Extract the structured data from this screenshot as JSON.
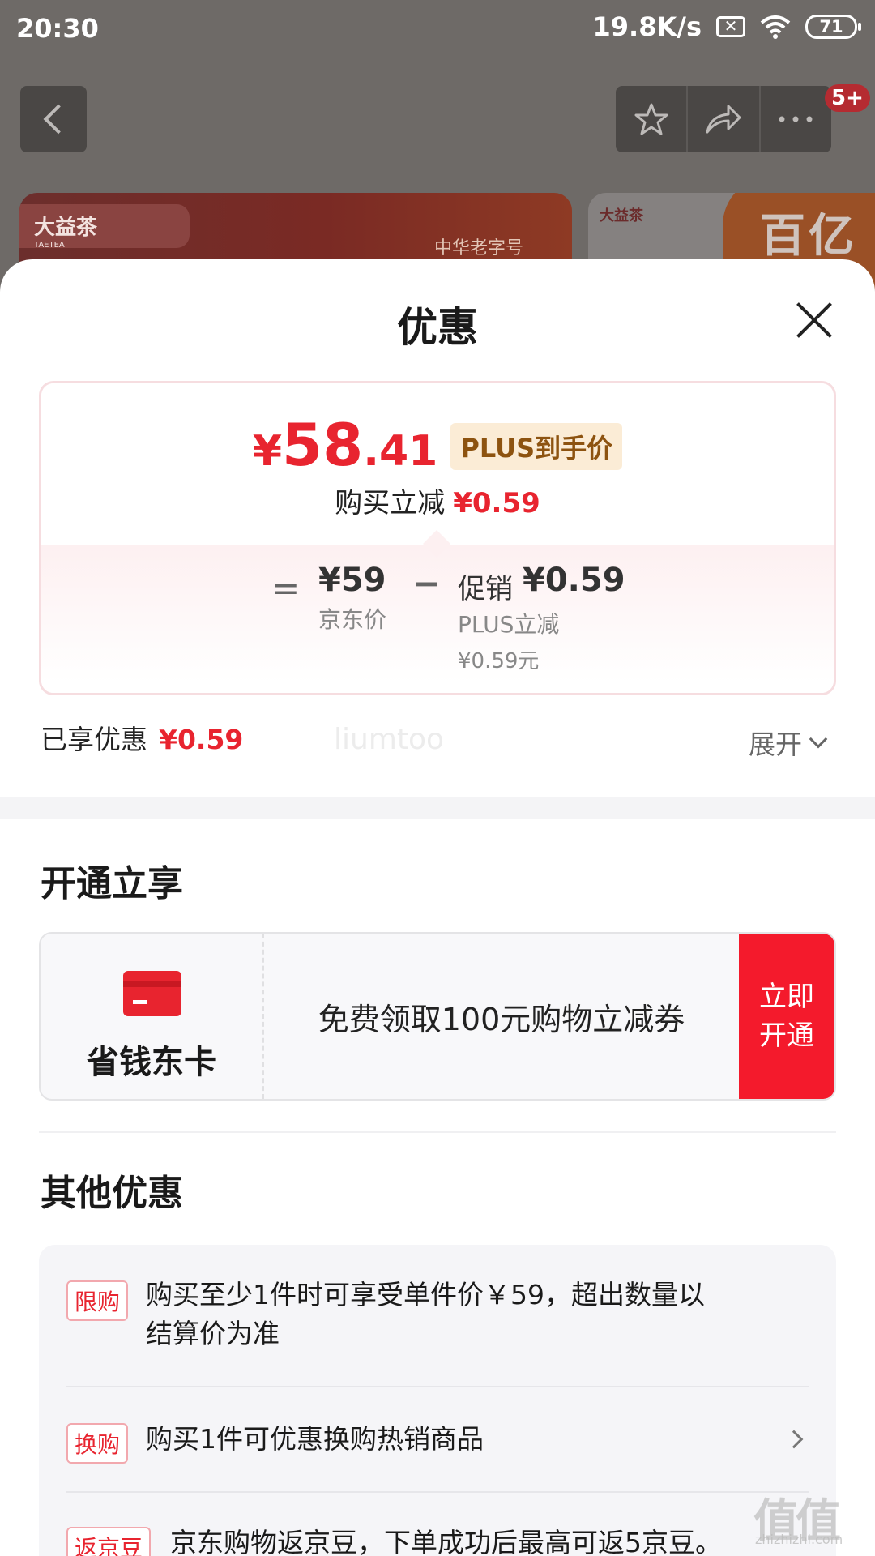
{
  "status_bar": {
    "time": "20:30",
    "speed": "19.8K/s",
    "battery": "71"
  },
  "background_page": {
    "badge": "5+",
    "banner_left_logo": "大益茶",
    "banner_left_logo_sub": "TAETEA",
    "banner_left_tag": "中华老字号",
    "banner_right_logo": "大益茶",
    "banner_right_text": "百亿"
  },
  "sheet": {
    "title": "优惠"
  },
  "price_card": {
    "currency": "¥",
    "price_int": "58",
    "price_dec": ".41",
    "plus_tag": "PLUS到手价",
    "save_label": "购买立减",
    "save_amount": "¥0.59",
    "equals": "=",
    "jd_price": "¥59",
    "jd_price_label": "京东价",
    "minus": "−",
    "promo_label": "促销",
    "promo_amount": "¥0.59",
    "plus_off_label": "PLUS立减",
    "plus_off_amount": "¥0.59元"
  },
  "enjoyed": {
    "label": "已享优惠",
    "amount": "¥0.59",
    "expand": "展开"
  },
  "watermark": "liumtoo",
  "open_section": {
    "title": "开通立享",
    "card_label": "省钱东卡",
    "description": "免费领取100元购物立减券",
    "button": "立即开通"
  },
  "other_section": {
    "title": "其他优惠",
    "offers": [
      {
        "tag": "限购",
        "text": "购买至少1件时可享受单件价￥59，超出数量以",
        "text2": "结算价为准"
      },
      {
        "tag": "换购",
        "text": "购买1件可优惠换购热销商品"
      },
      {
        "tag": "返京豆",
        "text": "京东购物返京豆，下单成功后最高可返5京豆。"
      }
    ]
  },
  "site_watermark": {
    "main": "值值值",
    "sub": "zhizhizhi.com"
  },
  "colors": {
    "accent_red": "#e8242f",
    "plus_gold": "#8d5310",
    "open_button": "#f41a2c"
  }
}
